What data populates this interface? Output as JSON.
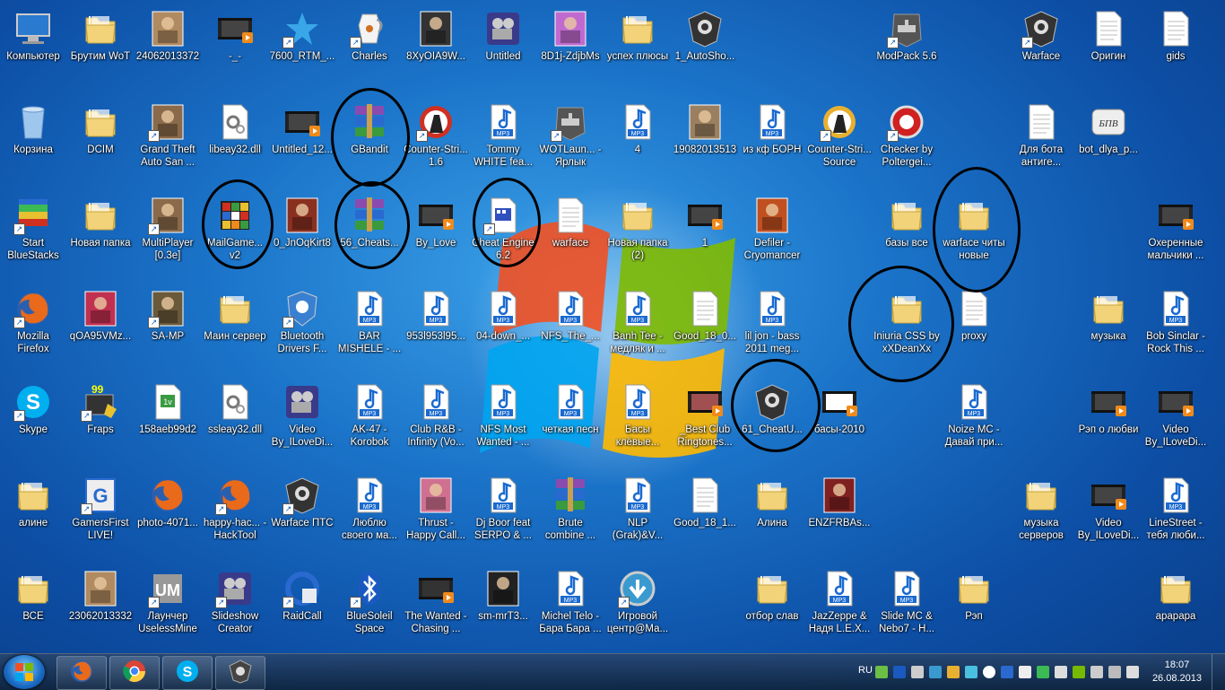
{
  "desktop": {
    "icons": [
      {
        "label": "Компьютер",
        "icon": "computer-icon",
        "color": "#cfe3f6",
        "shortcut": false
      },
      {
        "label": "Брутим WoT",
        "icon": "folder-icon",
        "color": "#f2d37a",
        "shortcut": false
      },
      {
        "label": "24062013372",
        "icon": "photo-icon",
        "color": "#b08a60",
        "shortcut": false
      },
      {
        "label": "-_-",
        "icon": "video-icon",
        "color": "#444",
        "shortcut": false
      },
      {
        "label": "7600_RTM_...",
        "icon": "star-shield-icon",
        "color": "#39a6e8",
        "shortcut": true
      },
      {
        "label": "Charles",
        "icon": "jug-icon",
        "color": "#e8e8e8",
        "shortcut": true
      },
      {
        "label": "8XyOIA9W...",
        "icon": "photo-icon",
        "color": "#333",
        "shortcut": false
      },
      {
        "label": "Untitled",
        "icon": "movie-maker-icon",
        "color": "#6a6ad0",
        "shortcut": false
      },
      {
        "label": "8D1j-ZdjbMs",
        "icon": "photo-icon",
        "color": "#c06ad0",
        "shortcut": false
      },
      {
        "label": "успех плюсы",
        "icon": "folder-icon",
        "color": "#f2d37a",
        "shortcut": false
      },
      {
        "label": "1_AutoSho...",
        "icon": "warface-icon",
        "color": "#555",
        "shortcut": false
      },
      {
        "label": "ModPack 5.6",
        "icon": "tank-icon",
        "color": "#555",
        "shortcut": true
      },
      {
        "label": "Warface",
        "icon": "warface-icon",
        "color": "#555",
        "shortcut": true
      },
      {
        "label": "Оригин",
        "icon": "text-file-icon",
        "color": "#fff",
        "shortcut": false
      },
      {
        "label": "gids",
        "icon": "text-file-icon",
        "color": "#fff",
        "shortcut": false
      },
      {
        "label": "Корзина",
        "icon": "recycle-bin-icon",
        "color": "#9fc6ec",
        "shortcut": false
      },
      {
        "label": "DCIM",
        "icon": "folder-icon",
        "color": "#f2d37a",
        "shortcut": false
      },
      {
        "label": "Grand Theft Auto San ...",
        "icon": "photo-icon",
        "color": "#8a6a4a",
        "shortcut": true
      },
      {
        "label": "libeay32.dll",
        "icon": "gear-file-icon",
        "color": "#ddd",
        "shortcut": false
      },
      {
        "label": "Untitled_12...",
        "icon": "video-icon",
        "color": "#444",
        "shortcut": false
      },
      {
        "label": "GBandit",
        "icon": "winrar-icon",
        "color": "#8a4bb0",
        "shortcut": false
      },
      {
        "label": "Counter-Stri... 1.6",
        "icon": "cs-icon",
        "color": "#d03020",
        "shortcut": true
      },
      {
        "label": "Tommy WHITE fea...",
        "icon": "mp3-icon",
        "color": "#fff",
        "shortcut": false
      },
      {
        "label": "WOTLaun... - Ярлык",
        "icon": "tank-icon",
        "color": "#555",
        "shortcut": true
      },
      {
        "label": "4",
        "icon": "mp3-icon",
        "color": "#fff",
        "shortcut": false
      },
      {
        "label": "19082013513",
        "icon": "photo-icon",
        "color": "#9a8060",
        "shortcut": false
      },
      {
        "label": "из кф БОРН",
        "icon": "mp3-icon",
        "color": "#fff",
        "shortcut": false
      },
      {
        "label": "Counter-Stri... Source",
        "icon": "cs-icon",
        "color": "#e8b030",
        "shortcut": true
      },
      {
        "label": "Checker by Poltergei...",
        "icon": "red-circle-icon",
        "color": "#d02020",
        "shortcut": true
      },
      {
        "label": "Для бота антиге...",
        "icon": "text-file-icon",
        "color": "#fff",
        "shortcut": false
      },
      {
        "label": "bot_dlya_p...",
        "icon": "bpv-icon",
        "color": "#eee",
        "shortcut": false
      },
      {
        "label": "Start BlueStacks",
        "icon": "bluestacks-icon",
        "color": "#3cba54",
        "shortcut": true
      },
      {
        "label": "Новая папка",
        "icon": "folder-icon",
        "color": "#f2d37a",
        "shortcut": false
      },
      {
        "label": "MultiPlayer [0.3e]",
        "icon": "photo-icon",
        "color": "#8a6a4a",
        "shortcut": true
      },
      {
        "label": "MailGame... v2",
        "icon": "rubik-icon",
        "color": "#d03020",
        "shortcut": false
      },
      {
        "label": "0_JnOqKirt8",
        "icon": "photo-icon",
        "color": "#8a3020",
        "shortcut": false
      },
      {
        "label": "56_Cheats...",
        "icon": "winrar-icon",
        "color": "#8a4bb0",
        "shortcut": false
      },
      {
        "label": "By_Love",
        "icon": "video-icon",
        "color": "#444",
        "shortcut": false
      },
      {
        "label": "Cheat Engine 6.2",
        "icon": "cheat-engine-icon",
        "color": "#3050c0",
        "shortcut": true
      },
      {
        "label": "warface",
        "icon": "text-file-icon",
        "color": "#fff",
        "shortcut": false
      },
      {
        "label": "Новая папка (2)",
        "icon": "folder-icon",
        "color": "#f2d37a",
        "shortcut": false
      },
      {
        "label": "1",
        "icon": "video-icon",
        "color": "#444",
        "shortcut": false
      },
      {
        "label": "Defiler - Cryomancer",
        "icon": "photo-icon",
        "color": "#c05020",
        "shortcut": false
      },
      {
        "label": "базы все",
        "icon": "folder-icon",
        "color": "#f2d37a",
        "shortcut": false
      },
      {
        "label": "warface читы новые",
        "icon": "folder-icon",
        "color": "#f2d37a",
        "shortcut": false
      },
      {
        "label": "Охеренные мальчики ...",
        "icon": "video-icon",
        "color": "#444",
        "shortcut": false
      },
      {
        "label": "Mozilla Firefox",
        "icon": "firefox-icon",
        "color": "#e86a1a",
        "shortcut": true
      },
      {
        "label": "qOA95VMz...",
        "icon": "photo-icon",
        "color": "#c03050",
        "shortcut": false
      },
      {
        "label": "SA-MP",
        "icon": "photo-icon",
        "color": "#6a5a3a",
        "shortcut": true
      },
      {
        "label": "Маин сервер",
        "icon": "folder-icon",
        "color": "#f2d37a",
        "shortcut": false
      },
      {
        "label": "Bluetooth Drivers F...",
        "icon": "shield-gear-icon",
        "color": "#3a80d0",
        "shortcut": true
      },
      {
        "label": "BAR MISHELE - ...",
        "icon": "mp3-icon",
        "color": "#fff",
        "shortcut": false
      },
      {
        "label": "953l953l95...",
        "icon": "mp3-icon",
        "color": "#fff",
        "shortcut": false
      },
      {
        "label": "04-down_...",
        "icon": "mp3-icon",
        "color": "#fff",
        "shortcut": false
      },
      {
        "label": "NFS_The_...",
        "icon": "mp3-icon",
        "color": "#fff",
        "shortcut": false
      },
      {
        "label": "Banh Tee - медляк и ...",
        "icon": "mp3-icon",
        "color": "#fff",
        "shortcut": false
      },
      {
        "label": "Good_18_0...",
        "icon": "text-file-icon",
        "color": "#fff",
        "shortcut": false
      },
      {
        "label": "lil jon - bass 2011 meg...",
        "icon": "mp3-icon",
        "color": "#fff",
        "shortcut": false
      },
      {
        "label": "Iniuria CSS by xXDeanXx",
        "icon": "folder-icon",
        "color": "#f2d37a",
        "shortcut": false
      },
      {
        "label": "proxy",
        "icon": "text-file-icon",
        "color": "#fff",
        "shortcut": false
      },
      {
        "label": "музыка",
        "icon": "folder-icon",
        "color": "#f2d37a",
        "shortcut": false
      },
      {
        "label": "Bob Sinclar - Rock This ...",
        "icon": "mp3-icon",
        "color": "#fff",
        "shortcut": false
      },
      {
        "label": "Skype",
        "icon": "skype-icon",
        "color": "#00aff0",
        "shortcut": true
      },
      {
        "label": "Fraps",
        "icon": "fraps-icon",
        "color": "#888",
        "shortcut": true
      },
      {
        "label": "158aeb99d2",
        "icon": "video-file-icon",
        "color": "#fff",
        "shortcut": false
      },
      {
        "label": "ssleay32.dll",
        "icon": "gear-file-icon",
        "color": "#ddd",
        "shortcut": false
      },
      {
        "label": "Video By_ILoveDi...",
        "icon": "movie-maker-icon",
        "color": "#6a6ad0",
        "shortcut": false
      },
      {
        "label": "AK-47 - Korobok",
        "icon": "mp3-icon",
        "color": "#fff",
        "shortcut": false
      },
      {
        "label": "Club R&B - Infinity (Vo...",
        "icon": "mp3-icon",
        "color": "#fff",
        "shortcut": false
      },
      {
        "label": "NFS Most Wanted - ...",
        "icon": "mp3-icon",
        "color": "#fff",
        "shortcut": false
      },
      {
        "label": "четкая песн",
        "icon": "mp3-icon",
        "color": "#fff",
        "shortcut": false
      },
      {
        "label": "Басы клёвые...",
        "icon": "mp3-icon",
        "color": "#fff",
        "shortcut": false
      },
      {
        "label": "_Best Club Ringtones...",
        "icon": "video-icon",
        "color": "#a05050",
        "shortcut": false
      },
      {
        "label": "61_CheatU...",
        "icon": "warface-icon",
        "color": "#555",
        "shortcut": false
      },
      {
        "label": "басы-2010",
        "icon": "video-icon",
        "color": "#fff",
        "shortcut": false
      },
      {
        "label": "Noize MC - Давай при...",
        "icon": "mp3-icon",
        "color": "#fff",
        "shortcut": false
      },
      {
        "label": "Рэп о любви",
        "icon": "video-icon",
        "color": "#444",
        "shortcut": false
      },
      {
        "label": "Video By_ILoveDi...",
        "icon": "video-icon",
        "color": "#444",
        "shortcut": false
      },
      {
        "label": "алине",
        "icon": "folder-icon",
        "color": "#f2d37a",
        "shortcut": false
      },
      {
        "label": "GamersFirst LIVE!",
        "icon": "gamersfirst-icon",
        "color": "#ddd",
        "shortcut": true
      },
      {
        "label": "photo-4071...",
        "icon": "firefox-icon",
        "color": "#e86a1a",
        "shortcut": false
      },
      {
        "label": "happy-hac... - HackTool",
        "icon": "firefox-icon",
        "color": "#e86a1a",
        "shortcut": true
      },
      {
        "label": "Warface ПТС",
        "icon": "warface-icon",
        "color": "#555",
        "shortcut": true
      },
      {
        "label": "Люблю своего ма...",
        "icon": "mp3-icon",
        "color": "#fff",
        "shortcut": false
      },
      {
        "label": "Thrust - Happy Call...",
        "icon": "photo-icon",
        "color": "#d07090",
        "shortcut": false
      },
      {
        "label": "Dj Boor feat SERPO & ...",
        "icon": "mp3-icon",
        "color": "#fff",
        "shortcut": false
      },
      {
        "label": "Brute combine ...",
        "icon": "winrar-icon",
        "color": "#8a4bb0",
        "shortcut": false
      },
      {
        "label": "NLP (Grak)&V...",
        "icon": "mp3-icon",
        "color": "#fff",
        "shortcut": false
      },
      {
        "label": "Good_18_1...",
        "icon": "text-file-icon",
        "color": "#fff",
        "shortcut": false
      },
      {
        "label": "Алина",
        "icon": "folder-icon",
        "color": "#f2d37a",
        "shortcut": false
      },
      {
        "label": "ENZFRBAs...",
        "icon": "photo-icon",
        "color": "#802020",
        "shortcut": false
      },
      {
        "label": "музыка серверов",
        "icon": "folder-icon",
        "color": "#f2d37a",
        "shortcut": false
      },
      {
        "label": "Video By_ILoveDi...",
        "icon": "video-icon",
        "color": "#444",
        "shortcut": false
      },
      {
        "label": "LineStreet - тебя люби...",
        "icon": "mp3-icon",
        "color": "#fff",
        "shortcut": false
      },
      {
        "label": "ВСЕ",
        "icon": "folder-icon",
        "color": "#f2d37a",
        "shortcut": false
      },
      {
        "label": "23062013332",
        "icon": "photo-icon",
        "color": "#b08a60",
        "shortcut": false
      },
      {
        "label": "Лаунчер UselessMine",
        "icon": "launcher-icon",
        "color": "#888",
        "shortcut": true
      },
      {
        "label": "Slideshow Creator",
        "icon": "movie-maker-icon",
        "color": "#6a6ad0",
        "shortcut": true
      },
      {
        "label": "RaidCall",
        "icon": "raidcall-icon",
        "color": "#2a6ad0",
        "shortcut": true
      },
      {
        "label": "BlueSoleil Space",
        "icon": "bluetooth-icon",
        "color": "#1a5ac0",
        "shortcut": true
      },
      {
        "label": "The Wanted - Chasing ...",
        "icon": "video-icon",
        "color": "#333",
        "shortcut": false
      },
      {
        "label": "sm-mrT3...",
        "icon": "photo-icon",
        "color": "#222",
        "shortcut": false
      },
      {
        "label": "Michel Telo - Бара Бара ...",
        "icon": "mp3-icon",
        "color": "#fff",
        "shortcut": false
      },
      {
        "label": "Игровой центр@Ма...",
        "icon": "download-icon",
        "color": "#3a9ad0",
        "shortcut": true
      },
      {
        "label": "отбор слав",
        "icon": "folder-icon",
        "color": "#f2d37a",
        "shortcut": false
      },
      {
        "label": "JazZeppe & Надя L.E.X...",
        "icon": "mp3-icon",
        "color": "#fff",
        "shortcut": false
      },
      {
        "label": "Slide MC & Nebo7 - H...",
        "icon": "mp3-icon",
        "color": "#fff",
        "shortcut": false
      },
      {
        "label": "Рэп",
        "icon": "folder-icon",
        "color": "#f2d37a",
        "shortcut": false
      },
      {
        "label": "арарара",
        "icon": "folder-icon",
        "color": "#f2d37a",
        "shortcut": false
      }
    ]
  },
  "taskbar": {
    "apps": [
      "firefox-icon",
      "chrome-icon",
      "skype-icon",
      "warface-icon"
    ],
    "language": "RU",
    "time": "18:07",
    "date": "26.08.2013"
  },
  "colors": {
    "annotation_circle": "#000000"
  }
}
